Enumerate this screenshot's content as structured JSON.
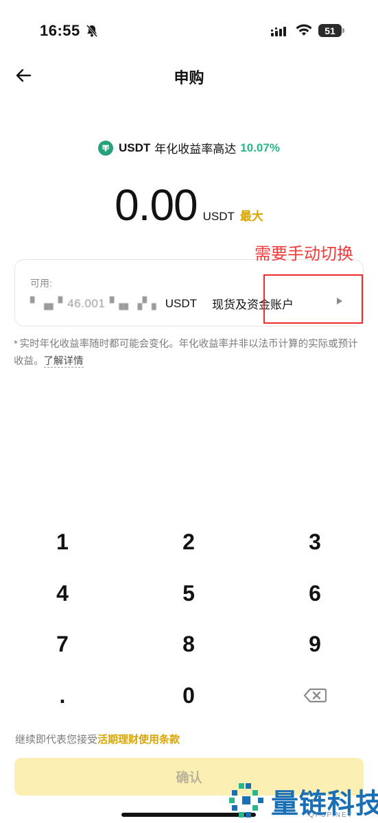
{
  "status_bar": {
    "time": "16:55",
    "battery": "51",
    "icons": [
      "bell-slash-icon",
      "signal-icon",
      "wifi-icon",
      "battery-icon"
    ]
  },
  "nav": {
    "title": "申购",
    "back_icon": "arrow-left-icon"
  },
  "rate": {
    "coin": "USDT",
    "label": "年化收益率高达",
    "value": "10.07%",
    "icon": "tether-icon",
    "color": "#2bb58a"
  },
  "amount": {
    "value": "0.00",
    "unit": "USDT",
    "max_label": "最大",
    "max_color": "#d9a500"
  },
  "annotation": {
    "text": "需要手动切换",
    "color": "#f23a3a"
  },
  "account": {
    "available_label": "可用:",
    "balance_blurred": "▘▗▖▘46.001▝▗▖▗▘▖",
    "balance_unit": "USDT",
    "account_name": "现货及资金账户",
    "arrow_icon": "triangle-right-icon"
  },
  "disclaimer": {
    "marker": "*",
    "text": "实时年化收益率随时都可能会变化。年化收益率并非以法币计算的实际或预计收益。",
    "link": "了解详情"
  },
  "keypad": {
    "keys": [
      "1",
      "2",
      "3",
      "4",
      "5",
      "6",
      "7",
      "8",
      "9",
      ".",
      "0"
    ],
    "backspace_icon": "backspace-icon"
  },
  "terms": {
    "prefix": "继续即代表您接受",
    "link": "活期理财使用条款"
  },
  "confirm": {
    "label": "确认",
    "bg_color": "#fcefb4"
  },
  "watermark": {
    "title": "量链科技",
    "url": "QFSP.NET",
    "color": "#1b6fb5"
  }
}
